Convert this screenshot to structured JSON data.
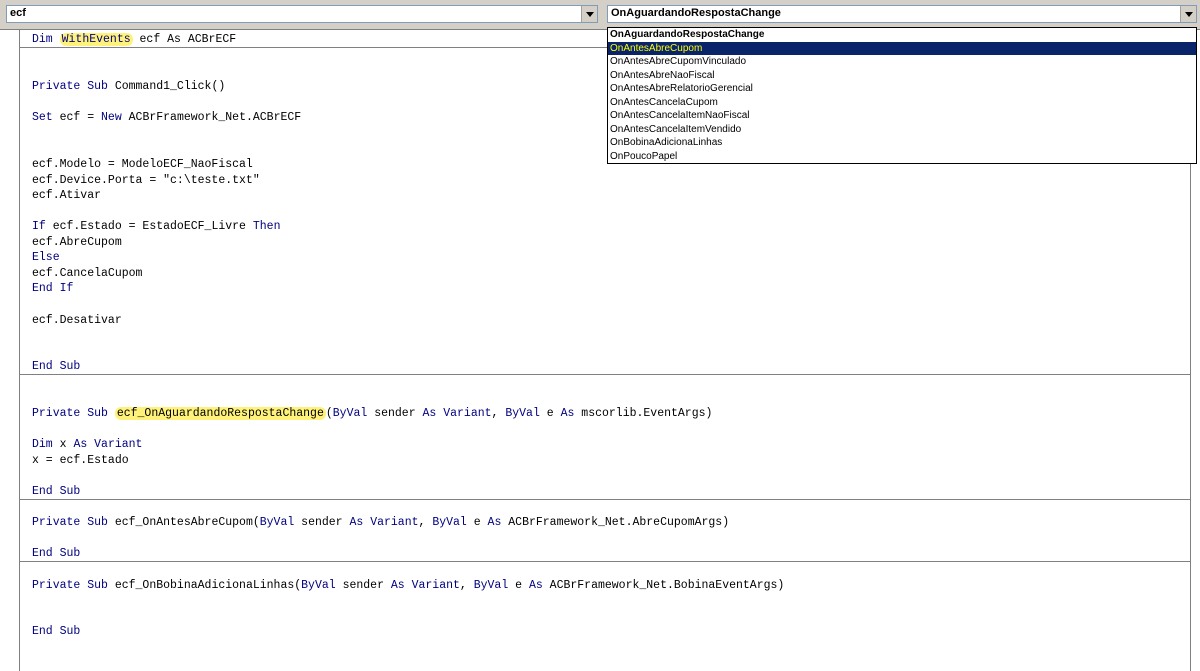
{
  "toolbar": {
    "object_combo": "ecf",
    "procedure_combo": "OnAguardandoRespostaChange"
  },
  "dropdown": {
    "items": [
      "OnAguardandoRespostaChange",
      "OnAntesAbreCupom",
      "OnAntesAbreCupomVinculado",
      "OnAntesAbreNaoFiscal",
      "OnAntesAbreRelatorioGerencial",
      "OnAntesCancelaCupom",
      "OnAntesCancelaItemNaoFiscal",
      "OnAntesCancelaItemVendido",
      "OnBobinaAdicionaLinhas",
      "OnPoucoPapel"
    ],
    "selected_index": 1
  },
  "code": {
    "l1": {
      "a": "Dim ",
      "b": "WithEvents",
      "c": " ecf As ACBrECF"
    },
    "l2": {
      "a": "Private Sub",
      "b": " Command1_Click()"
    },
    "l3": {
      "a": "Set",
      "b": " ecf = ",
      "c": "New",
      "d": " ACBrFramework_Net.ACBrECF"
    },
    "l4": "ecf.Modelo = ModeloECF_NaoFiscal",
    "l5": "ecf.Device.Porta = \"c:\\teste.txt\"",
    "l6": "ecf.Ativar",
    "l7": {
      "a": "If",
      "b": " ecf.Estado = EstadoECF_Livre ",
      "c": "Then"
    },
    "l8": "ecf.AbreCupom",
    "l9": "Else",
    "l10": "ecf.CancelaCupom",
    "l11": "End If",
    "l12": "ecf.Desativar",
    "l13": "End Sub",
    "l14": {
      "a": "Private Sub ",
      "b": "ecf_OnAguardandoRespostaChange",
      "c": "(",
      "d": "ByVal",
      "e": " sender ",
      "f": "As Variant",
      "g": ", ",
      "h": "ByVal",
      "i": " e ",
      "j": "As",
      "k": " mscorlib.EventArgs)"
    },
    "l15": {
      "a": "Dim",
      "b": " x ",
      "c": "As Variant"
    },
    "l16": "x = ecf.Estado",
    "l17": "End Sub",
    "l18": {
      "a": "Private Sub",
      "b": " ecf_OnAntesAbreCupom(",
      "c": "ByVal",
      "d": " sender ",
      "e": "As Variant",
      "f": ", ",
      "g": "ByVal",
      "h": " e ",
      "i": "As",
      "j": " ACBrFramework_Net.AbreCupomArgs)"
    },
    "l19": "End Sub",
    "l20": {
      "a": "Private Sub",
      "b": " ecf_OnBobinaAdicionaLinhas(",
      "c": "ByVal",
      "d": " sender ",
      "e": "As Variant",
      "f": ", ",
      "g": "ByVal",
      "h": " e ",
      "i": "As",
      "j": " ACBrFramework_Net.BobinaEventArgs)"
    },
    "l21": "End Sub"
  }
}
